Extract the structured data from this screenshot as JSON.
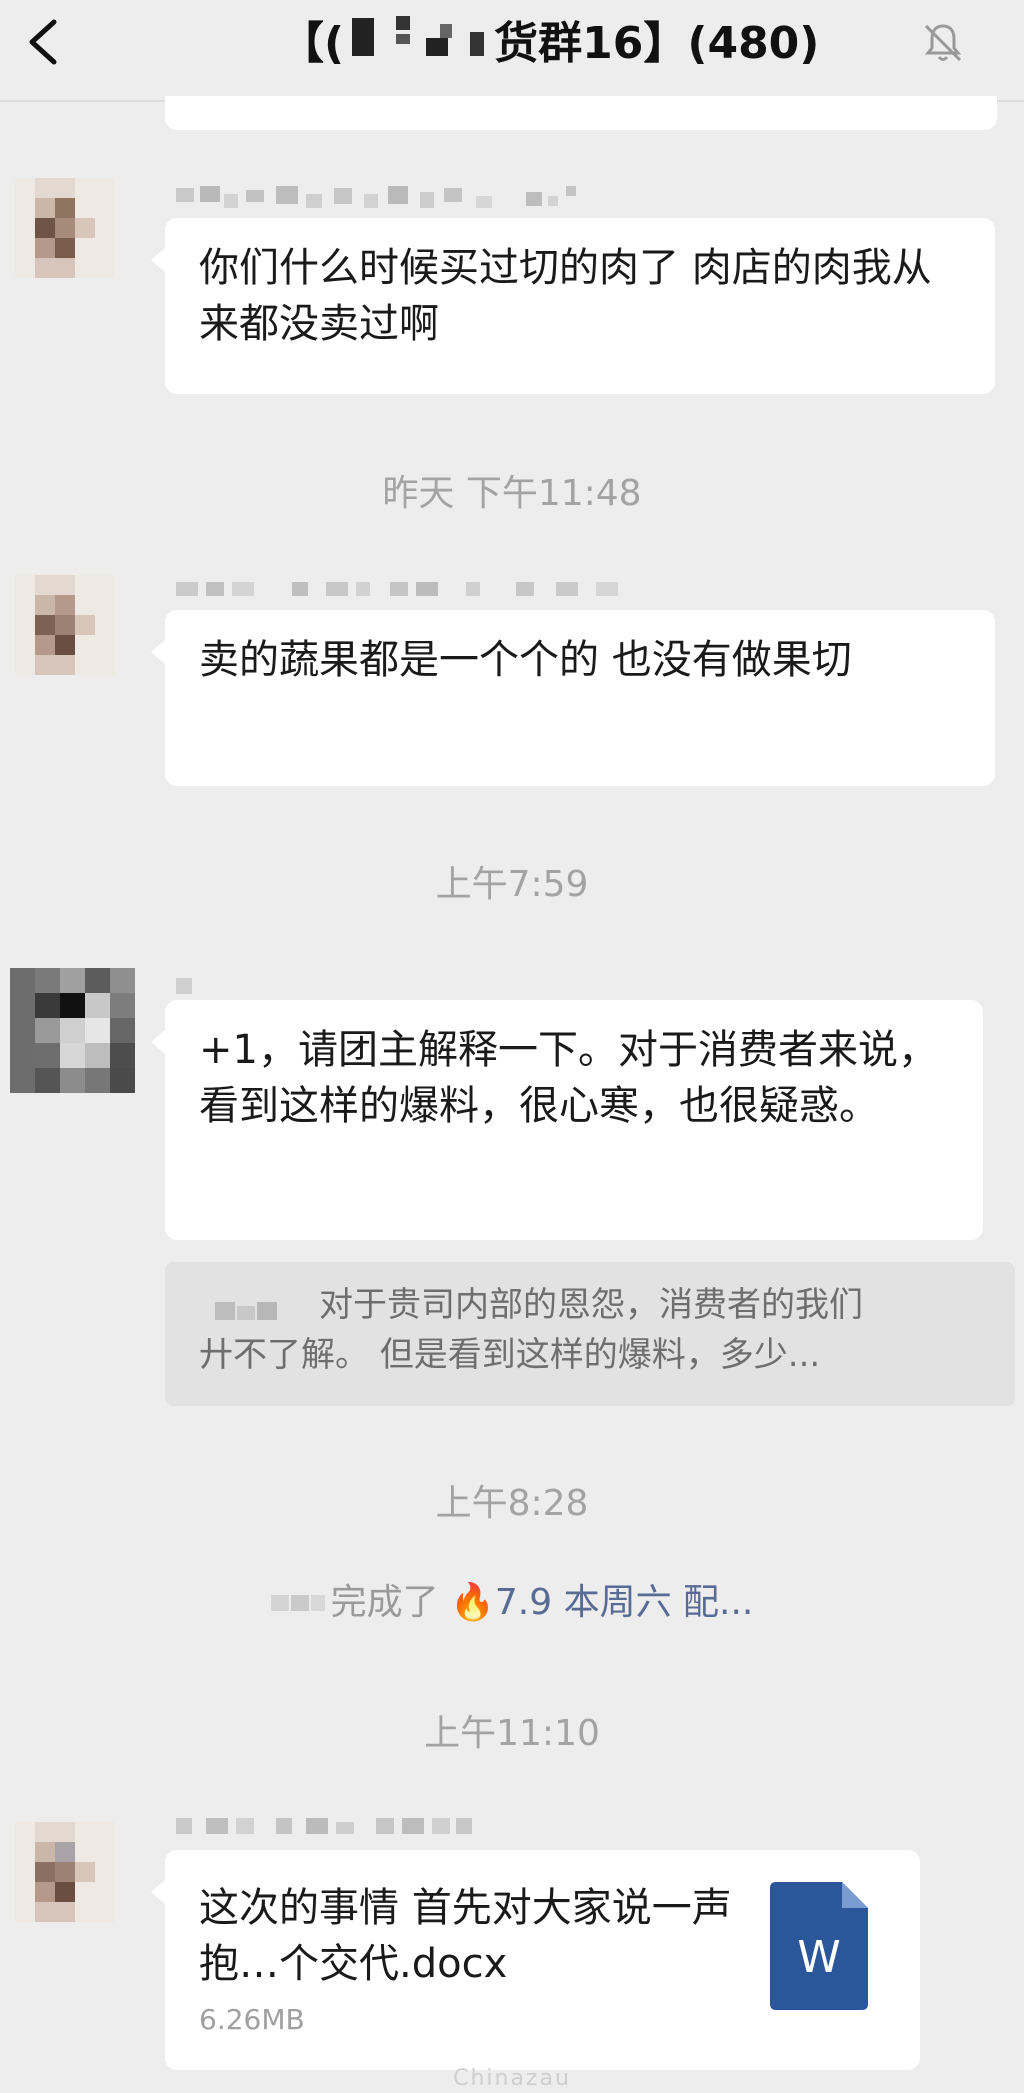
{
  "header": {
    "title_prefix": "【(",
    "title_suffix": "货群16】",
    "member_count": "(480)"
  },
  "messages": [
    {
      "text": "你们什么时候买过切的肉了 肉店的肉我从来都没卖过啊"
    },
    {
      "time": "昨天 下午11:48"
    },
    {
      "text": "卖的蔬果都是一个个的 也没有做果切"
    },
    {
      "time": "上午7:59"
    },
    {
      "text": "+1，请团主解释一下。对于消费者来说，看到这样的爆料，很心寒，也很疑惑。"
    }
  ],
  "quote": {
    "line1": "对于贵司内部的恩怨，消费者的我们",
    "line2": "廾不了解。 但是看到这样的爆料，多少..."
  },
  "times": {
    "t3": "上午8:28",
    "t4": "上午11:10"
  },
  "system_message": {
    "text": "完成了",
    "emoji": "🔥",
    "link": "7.9 本周六 配..."
  },
  "file": {
    "name": "这次的事情 首先对大家说一声抱…个交代.docx",
    "size": "6.26MB",
    "icon_letter": "W"
  },
  "colors": {
    "background": "#ededed",
    "bubble": "#ffffff",
    "link": "#576b95",
    "word_blue": "#2b579a"
  },
  "watermark": "Chinazau"
}
